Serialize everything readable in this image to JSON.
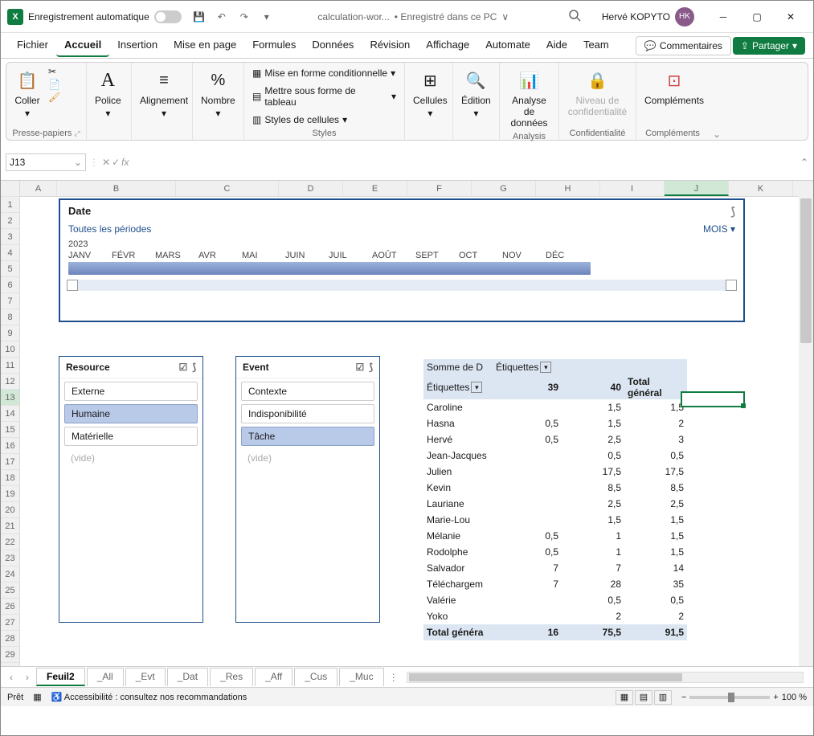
{
  "titlebar": {
    "autosave_label": "Enregistrement automatique",
    "filename": "calculation-wor...",
    "save_location": "• Enregistré dans ce PC",
    "user": "Hervé KOPYTO",
    "avatar_initials": "HK"
  },
  "menu": {
    "items": [
      "Fichier",
      "Accueil",
      "Insertion",
      "Mise en page",
      "Formules",
      "Données",
      "Révision",
      "Affichage",
      "Automate",
      "Aide",
      "Team"
    ],
    "active_index": 1,
    "comments": "Commentaires",
    "share": "Partager"
  },
  "ribbon": {
    "clipboard": {
      "paste": "Coller",
      "label": "Presse-papiers"
    },
    "font": {
      "label": "Police",
      "btn": "Police"
    },
    "align": {
      "label": "Alignement",
      "btn": "Alignement"
    },
    "number": {
      "label": "Nombre",
      "btn": "Nombre"
    },
    "styles": {
      "cond": "Mise en forme conditionnelle",
      "table": "Mettre sous forme de tableau",
      "cell": "Styles de cellules",
      "label": "Styles"
    },
    "cells": {
      "btn": "Cellules"
    },
    "editing": {
      "btn": "Édition"
    },
    "analysis": {
      "btn": "Analyse de données",
      "label": "Analysis"
    },
    "sensitivity": {
      "btn": "Niveau de confidentialité",
      "label": "Confidentialité"
    },
    "addins": {
      "btn": "Compléments",
      "label": "Compléments"
    }
  },
  "namebox": "J13",
  "columns": [
    "A",
    "B",
    "C",
    "D",
    "E",
    "F",
    "G",
    "H",
    "I",
    "J",
    "K"
  ],
  "row_count": 29,
  "timeline": {
    "title": "Date",
    "subtitle": "Toutes les périodes",
    "level": "MOIS",
    "year": "2023",
    "months": [
      "JANV",
      "FÉVR",
      "MARS",
      "AVR",
      "MAI",
      "JUIN",
      "JUIL",
      "AOÛT",
      "SEPT",
      "OCT",
      "NOV",
      "DÉC"
    ]
  },
  "slicers": [
    {
      "title": "Resource",
      "items": [
        {
          "label": "Externe",
          "sel": false
        },
        {
          "label": "Humaine",
          "sel": true
        },
        {
          "label": "Matérielle",
          "sel": false
        }
      ],
      "vide": "(vide)"
    },
    {
      "title": "Event",
      "items": [
        {
          "label": "Contexte",
          "sel": false
        },
        {
          "label": "Indisponibilité",
          "sel": false
        },
        {
          "label": "Tâche",
          "sel": true
        }
      ],
      "vide": "(vide)"
    }
  ],
  "pivot": {
    "measure": "Somme de D",
    "col_field": "Étiquettes",
    "row_field": "Étiquettes",
    "cols": [
      "39",
      "40",
      "Total général"
    ],
    "rows": [
      {
        "label": "Caroline",
        "v": [
          "",
          "1,5",
          "1,5"
        ]
      },
      {
        "label": "Hasna",
        "v": [
          "0,5",
          "1,5",
          "2"
        ]
      },
      {
        "label": "Hervé",
        "v": [
          "0,5",
          "2,5",
          "3"
        ]
      },
      {
        "label": "Jean-Jacques",
        "v": [
          "",
          "0,5",
          "0,5"
        ]
      },
      {
        "label": "Julien",
        "v": [
          "",
          "17,5",
          "17,5"
        ]
      },
      {
        "label": "Kevin",
        "v": [
          "",
          "8,5",
          "8,5"
        ]
      },
      {
        "label": "Lauriane",
        "v": [
          "",
          "2,5",
          "2,5"
        ]
      },
      {
        "label": "Marie-Lou",
        "v": [
          "",
          "1,5",
          "1,5"
        ]
      },
      {
        "label": "Mélanie",
        "v": [
          "0,5",
          "1",
          "1,5"
        ]
      },
      {
        "label": "Rodolphe",
        "v": [
          "0,5",
          "1",
          "1,5"
        ]
      },
      {
        "label": "Salvador",
        "v": [
          "7",
          "7",
          "14"
        ]
      },
      {
        "label": "Téléchargem",
        "v": [
          "7",
          "28",
          "35"
        ]
      },
      {
        "label": "Valérie",
        "v": [
          "",
          "0,5",
          "0,5"
        ]
      },
      {
        "label": "Yoko",
        "v": [
          "",
          "2",
          "2"
        ]
      }
    ],
    "grand": {
      "label": "Total généra",
      "v": [
        "16",
        "75,5",
        "91,5"
      ]
    }
  },
  "sheets": {
    "tabs": [
      "Feuil2",
      "_All",
      "_Evt",
      "_Dat",
      "_Res",
      "_Aff",
      "_Cus",
      "_Muc"
    ],
    "active": 0
  },
  "status": {
    "ready": "Prêt",
    "access": "Accessibilité : consultez nos recommandations",
    "zoom": "100 %"
  }
}
